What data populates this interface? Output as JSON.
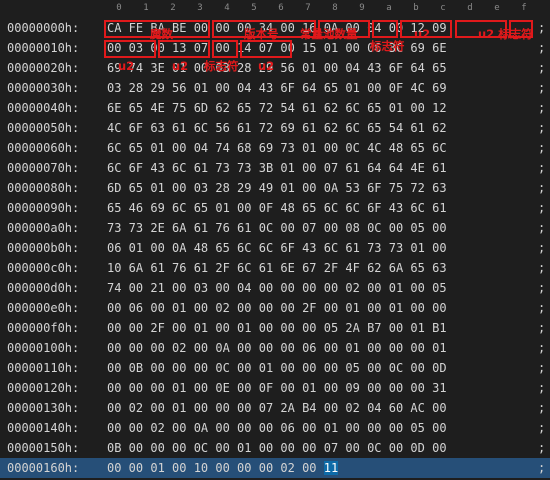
{
  "header_columns": [
    "0",
    "1",
    "2",
    "3",
    "4",
    "5",
    "6",
    "7",
    "8",
    "9",
    "a",
    "b",
    "c",
    "d",
    "e",
    "f"
  ],
  "rows": [
    {
      "addr": "00000000h:",
      "hex": "CA FE BA BE 00 00 00 34 00 16 0A 00 04 00 12 09"
    },
    {
      "addr": "00000010h:",
      "hex": "00 03 00 13 07 00 14 07 00 15 01 00 06 3C 69 6E"
    },
    {
      "addr": "00000020h:",
      "hex": "69 74 3E 01 00 03 28 29 56 01 00 04 43 6F 64 65"
    },
    {
      "addr": "00000030h:",
      "hex": "03 28 29 56 01 00 04 43 6F 64 65 01 00 0F 4C 69"
    },
    {
      "addr": "00000040h:",
      "hex": "6E 65 4E 75 6D 62 65 72 54 61 62 6C 65 01 00 12"
    },
    {
      "addr": "00000050h:",
      "hex": "4C 6F 63 61 6C 56 61 72 69 61 62 6C 65 54 61 62"
    },
    {
      "addr": "00000060h:",
      "hex": "6C 65 01 00 04 74 68 69 73 01 00 0C 4C 48 65 6C"
    },
    {
      "addr": "00000070h:",
      "hex": "6C 6F 43 6C 61 73 73 3B 01 00 07 61 64 64 4E 61"
    },
    {
      "addr": "00000080h:",
      "hex": "6D 65 01 00 03 28 29 49 01 00 0A 53 6F 75 72 63"
    },
    {
      "addr": "00000090h:",
      "hex": "65 46 69 6C 65 01 00 0F 48 65 6C 6C 6F 43 6C 61"
    },
    {
      "addr": "000000a0h:",
      "hex": "73 73 2E 6A 61 76 61 0C 00 07 00 08 0C 00 05 00"
    },
    {
      "addr": "000000b0h:",
      "hex": "06 01 00 0A 48 65 6C 6C 6F 43 6C 61 73 73 01 00"
    },
    {
      "addr": "000000c0h:",
      "hex": "10 6A 61 76 61 2F 6C 61 6E 67 2F 4F 62 6A 65 63"
    },
    {
      "addr": "000000d0h:",
      "hex": "74 00 21 00 03 00 04 00 00 00 00 02 00 01 00 05"
    },
    {
      "addr": "000000e0h:",
      "hex": "00 06 00 01 00 02 00 00 00 2F 00 01 00 01 00 00"
    },
    {
      "addr": "000000f0h:",
      "hex": "00 00 2F 00 01 00 01 00 00 00 05 2A B7 00 01 B1"
    },
    {
      "addr": "00000100h:",
      "hex": "00 00 00 02 00 0A 00 00 00 06 00 01 00 00 00 01"
    },
    {
      "addr": "00000110h:",
      "hex": "00 0B 00 00 00 0C 00 01 00 00 00 05 00 0C 00 0D"
    },
    {
      "addr": "00000120h:",
      "hex": "00 00 00 01 00 0E 00 0F 00 01 00 09 00 00 00 31"
    },
    {
      "addr": "00000130h:",
      "hex": "00 02 00 01 00 00 00 07 2A B4 00 02 04 60 AC 00"
    },
    {
      "addr": "00000140h:",
      "hex": "00 00 02 00 0A 00 00 00 06 00 01 00 00 00 05 00"
    },
    {
      "addr": "00000150h:",
      "hex": "0B 00 00 00 0C 00 01 00 00 00 07 00 0C 00 0D 00"
    },
    {
      "addr": "00000160h:",
      "hex": "00 00 01 00 10 00 00 00 02 00 11"
    }
  ],
  "row_terminator": ";",
  "annotations": {
    "magic": "魔数",
    "minor_version": "版本号",
    "constant_pool_count": "常量池数量",
    "u2_top": "u2",
    "u2_index": "u2 标志符",
    "u2_second_row_1": "u2",
    "u2_second_row_2": "u2",
    "flag_label": "标志符",
    "index_label": "标志符",
    "u2_third": "u2"
  },
  "colors": {
    "background": "#1e1e1e",
    "text": "#d4d4d4",
    "annotation_red": "#e0191b",
    "selected_row": "#264f78",
    "highlight_byte": "#0e6ba8"
  }
}
